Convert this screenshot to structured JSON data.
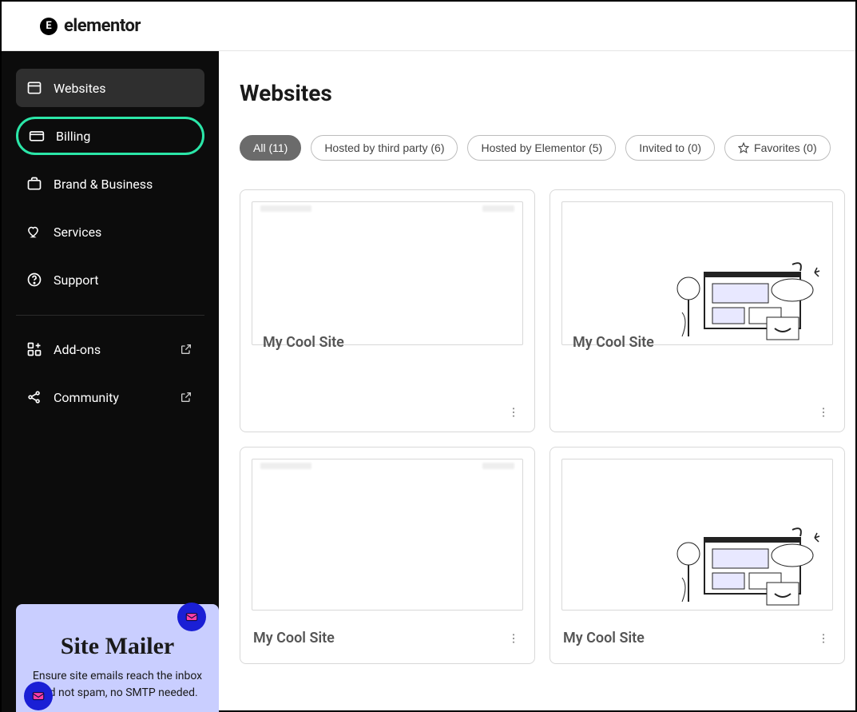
{
  "brand": {
    "name": "elementor",
    "mark": "E"
  },
  "sidebar": {
    "items": [
      {
        "label": "Websites",
        "icon": "window",
        "active": true,
        "highlighted": false
      },
      {
        "label": "Billing",
        "icon": "card",
        "active": false,
        "highlighted": true
      },
      {
        "label": "Brand & Business",
        "icon": "briefcase",
        "active": false,
        "highlighted": false
      },
      {
        "label": "Services",
        "icon": "heart-hands",
        "active": false,
        "highlighted": false
      },
      {
        "label": "Support",
        "icon": "help",
        "active": false,
        "highlighted": false
      }
    ],
    "secondary": [
      {
        "label": "Add-ons",
        "icon": "grid-plus",
        "external": true
      },
      {
        "label": "Community",
        "icon": "share-nodes",
        "external": true
      }
    ]
  },
  "promo": {
    "title": "Site Mailer",
    "text": "Ensure site emails reach the inbox and not spam, no SMTP needed."
  },
  "page": {
    "title": "Websites"
  },
  "filters": [
    {
      "label": "All (11)",
      "active": true
    },
    {
      "label": "Hosted by third party (6)",
      "active": false
    },
    {
      "label": "Hosted by Elementor (5)",
      "active": false
    },
    {
      "label": "Invited to (0)",
      "active": false
    },
    {
      "label": "Favorites (0)",
      "active": false,
      "icon": "star"
    }
  ],
  "sites": [
    {
      "title": "My Cool Site",
      "illustration": false
    },
    {
      "title": "My Cool Site",
      "illustration": true
    },
    {
      "title": "My Cool Site",
      "illustration": false
    },
    {
      "title": "My Cool Site",
      "illustration": true
    }
  ]
}
